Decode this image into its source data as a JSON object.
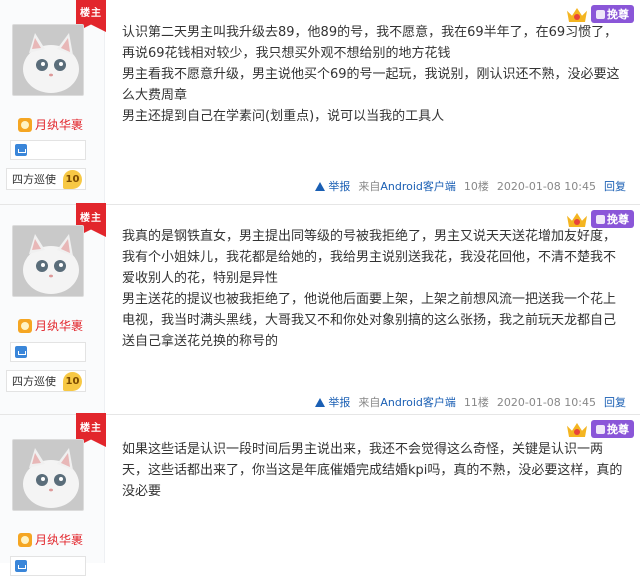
{
  "colors": {
    "accent_red": "#e2262c",
    "link_blue": "#1a5fb4",
    "vip_purple": "#8a56d8"
  },
  "badges": {
    "louzhu": "楼主",
    "zun": "挽尊"
  },
  "posts": [
    {
      "user": {
        "name": "月纨华裹",
        "rank": "四方巡使",
        "level": "10"
      },
      "content": [
        "认识第二天男主叫我升级去89，他89的号，我不愿意，我在69半年了，在69习惯了，再说69花钱相对较少，我只想买外观不想给别的地方花钱",
        "男主看我不愿意升级，男主说他买个69的号一起玩，我说别，刚认识还不熟，没必要这么大费周章",
        "男主还提到自己在学素问(划重点)，说可以当我的工具人"
      ],
      "footer": {
        "report": "举报",
        "source_prefix": "来自",
        "source_link": "Android客户端",
        "floor": "10楼",
        "time": "2020-01-08 10:45",
        "reply": "回复"
      }
    },
    {
      "user": {
        "name": "月纨华裹",
        "rank": "四方巡使",
        "level": "10"
      },
      "content": [
        "我真的是钢铁直女，男主提出同等级的号被我拒绝了，男主又说天天送花增加友好度，我有个小姐妹儿，我花都是给她的，我给男主说别送我花，我没花回他，不清不楚我不爱收别人的花，特别是异性",
        "男主送花的提议也被我拒绝了，他说他后面要上架，上架之前想风流一把送我一个花上电视，我当时满头黑线，大哥我又不和你处对象别搞的这么张扬，我之前玩天龙都自己送自己拿送花兑换的称号的"
      ],
      "footer": {
        "report": "举报",
        "source_prefix": "来自",
        "source_link": "Android客户端",
        "floor": "11楼",
        "time": "2020-01-08 10:45",
        "reply": "回复"
      }
    },
    {
      "user": {
        "name": "月纨华裹"
      },
      "content": [
        "如果这些话是认识一段时间后男主说出来，我还不会觉得这么奇怪，关键是认识一两天，这些话都出来了，你当这是年底催婚完成结婚kpi吗，真的不熟，没必要这样，真的没必要"
      ]
    }
  ]
}
